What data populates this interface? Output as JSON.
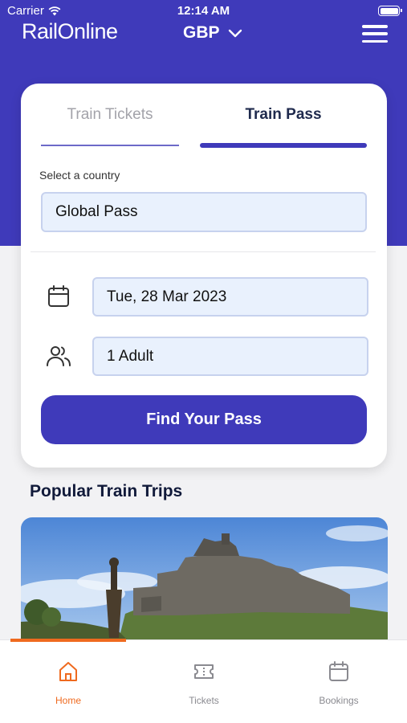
{
  "status_bar": {
    "carrier": "Carrier",
    "time": "12:14 AM"
  },
  "header": {
    "logo": "RailOnline",
    "currency": "GBP"
  },
  "booking_card": {
    "tabs": [
      {
        "label": "Train Tickets",
        "active": false
      },
      {
        "label": "Train Pass",
        "active": true
      }
    ],
    "country_label": "Select a country",
    "country_value": "Global Pass",
    "date_value": "Tue, 28 Mar 2023",
    "passengers_value": "1 Adult",
    "submit_label": "Find Your Pass"
  },
  "popular": {
    "title": "Popular Train Trips"
  },
  "bottom_nav": {
    "items": [
      {
        "label": "Home",
        "icon": "home-icon",
        "active": true
      },
      {
        "label": "Tickets",
        "icon": "ticket-icon",
        "active": false
      },
      {
        "label": "Bookings",
        "icon": "calendar-icon",
        "active": false
      }
    ]
  },
  "colors": {
    "brand": "#3f3aba",
    "accent": "#ef6a1f",
    "field_bg": "#e9f1fd",
    "page_bg": "#f2f2f4"
  }
}
